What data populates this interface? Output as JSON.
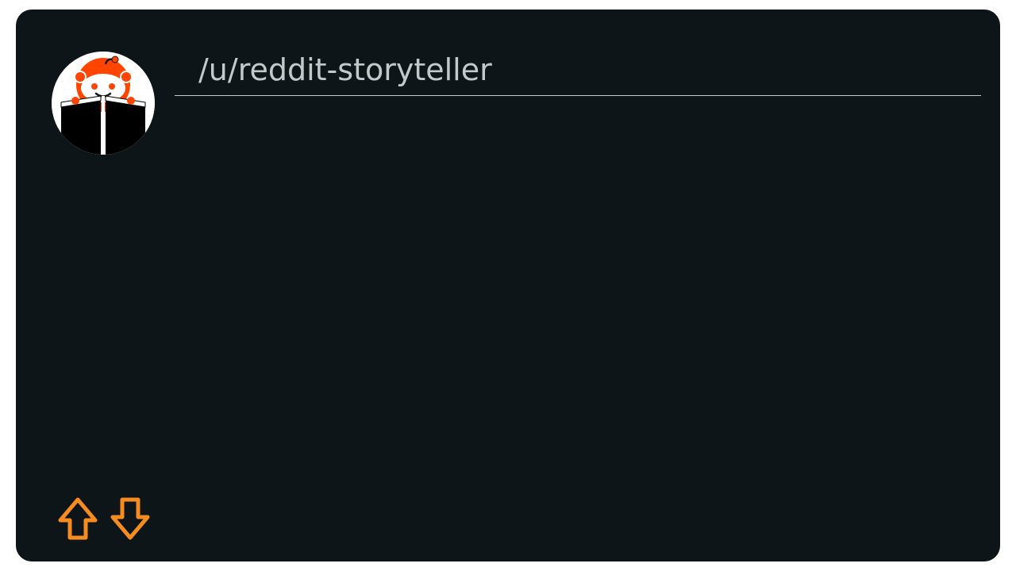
{
  "post": {
    "username": "/u/reddit-storyteller"
  },
  "icons": {
    "avatar": "reddit-snoo-reading-book-icon",
    "upvote": "upvote-arrow-icon",
    "downvote": "downvote-arrow-icon"
  },
  "colors": {
    "card_background": "#0d1518",
    "username_text": "#c3c9cb",
    "vote_accent": "#f68b1f",
    "snoo_orange": "#ff4500"
  }
}
